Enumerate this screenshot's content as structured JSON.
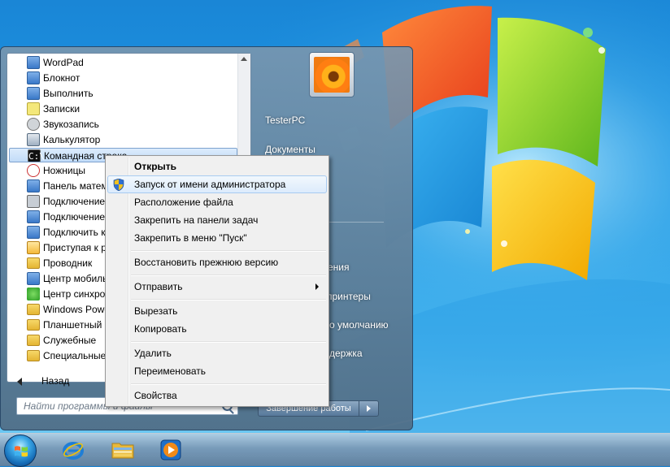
{
  "colors": {
    "wallpaper_blue": "#1e96e4",
    "menu_selection": "#c2dcf8",
    "context_highlight_border": "#a8cbf1"
  },
  "start_menu": {
    "programs": [
      {
        "label": "WordPad",
        "icon": "wordpad-icon"
      },
      {
        "label": "Блокнот",
        "icon": "notepad-icon"
      },
      {
        "label": "Выполнить",
        "icon": "run-icon"
      },
      {
        "label": "Записки",
        "icon": "sticky-notes-icon"
      },
      {
        "label": "Звукозапись",
        "icon": "sound-recorder-icon"
      },
      {
        "label": "Калькулятор",
        "icon": "calculator-icon"
      },
      {
        "label": "Командная строка",
        "icon": "command-prompt-icon"
      },
      {
        "label": "Ножницы",
        "icon": "snipping-tool-icon"
      },
      {
        "label": "Панель математического ввода",
        "icon": "math-input-icon"
      },
      {
        "label": "Подключение к сетевому проектору",
        "icon": "network-projector-icon"
      },
      {
        "label": "Подключение к удаленному рабочему столу",
        "icon": "remote-desktop-icon"
      },
      {
        "label": "Подключить к проектору",
        "icon": "projector-icon"
      },
      {
        "label": "Приступая к работе",
        "icon": "getting-started-icon"
      },
      {
        "label": "Проводник",
        "icon": "explorer-icon"
      },
      {
        "label": "Центр мобильности Windows",
        "icon": "mobility-center-icon"
      },
      {
        "label": "Центр синхронизации",
        "icon": "sync-center-icon"
      },
      {
        "label": "Windows PowerShell",
        "icon": "folder-icon"
      },
      {
        "label": "Планшетный ПК",
        "icon": "folder-icon"
      },
      {
        "label": "Служебные",
        "icon": "folder-icon"
      },
      {
        "label": "Специальные возможности",
        "icon": "folder-icon"
      }
    ],
    "back_label": "Назад",
    "search_placeholder": "Найти программы и файлы",
    "user_name": "TesterPC",
    "right_items": {
      "documents": "Документы",
      "control_panel_tail": "ления",
      "devices_tail": "принтеры",
      "defaults_tail": "о умолчанию",
      "help_tail": "держка"
    },
    "shutdown_label": "Завершение работы"
  },
  "context_menu": {
    "items": [
      {
        "label": "Открыть",
        "bold": true
      },
      {
        "label": "Запуск от имени администратора",
        "highlighted": true,
        "icon": "uac-shield-icon"
      },
      {
        "label": "Расположение файла"
      },
      {
        "label": "Закрепить на панели задач"
      },
      {
        "label": "Закрепить в меню \"Пуск\""
      },
      {
        "label": "Восстановить прежнюю версию"
      },
      {
        "label": "Отправить",
        "submenu": true
      },
      {
        "label": "Вырезать"
      },
      {
        "label": "Копировать"
      },
      {
        "label": "Удалить"
      },
      {
        "label": "Переименовать"
      },
      {
        "label": "Свойства"
      }
    ]
  },
  "taskbar": {
    "pinned": [
      "internet-explorer-icon",
      "windows-explorer-icon",
      "media-player-icon"
    ]
  }
}
